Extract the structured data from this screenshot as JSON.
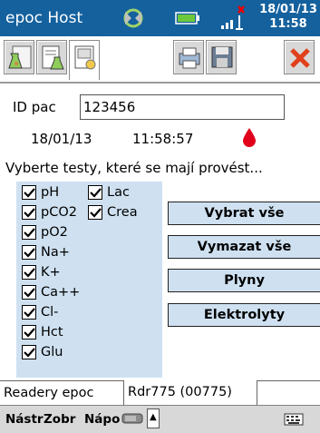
{
  "titlebar": {
    "title": "epoc Host",
    "date": "18/01/13",
    "time": "11:58",
    "icons": [
      "sync-icon",
      "battery-icon",
      "signal-icon"
    ]
  },
  "toolbar": {
    "buttons": [
      "flask-test-icon",
      "document-flask-icon",
      "card-icon",
      "printer-icon",
      "save-icon",
      "close-icon"
    ]
  },
  "patient": {
    "id_label": "ID pac",
    "id_value": "123456",
    "date": "18/01/13",
    "time": "11:58:57"
  },
  "prompt": "Vyberte testy, které se mají provést...",
  "tests": [
    {
      "label": "pH",
      "checked": true
    },
    {
      "label": "Lac",
      "checked": true
    },
    {
      "label": "pCO2",
      "checked": true
    },
    {
      "label": "Crea",
      "checked": true
    },
    {
      "label": "pO2",
      "checked": true
    },
    {
      "label": "Na+",
      "checked": true
    },
    {
      "label": "K+",
      "checked": true
    },
    {
      "label": "Ca++",
      "checked": true
    },
    {
      "label": "Cl-",
      "checked": true
    },
    {
      "label": "Hct",
      "checked": true
    },
    {
      "label": "Glu",
      "checked": true
    }
  ],
  "actions": {
    "select_all": "Vybrat vše",
    "clear_all": "Vymazat vše",
    "gases": "Plyny",
    "electrolytes": "Elektrolyty"
  },
  "tabs": {
    "readers": "Readery epoc",
    "reader": "Rdr775 (00775)"
  },
  "menubar": {
    "settings": "Nástr",
    "view": "Zobr",
    "help": "Nápo"
  },
  "colors": {
    "titlebar": "#14619e",
    "panel": "#cfe1f1",
    "drop": "#e0001b"
  }
}
